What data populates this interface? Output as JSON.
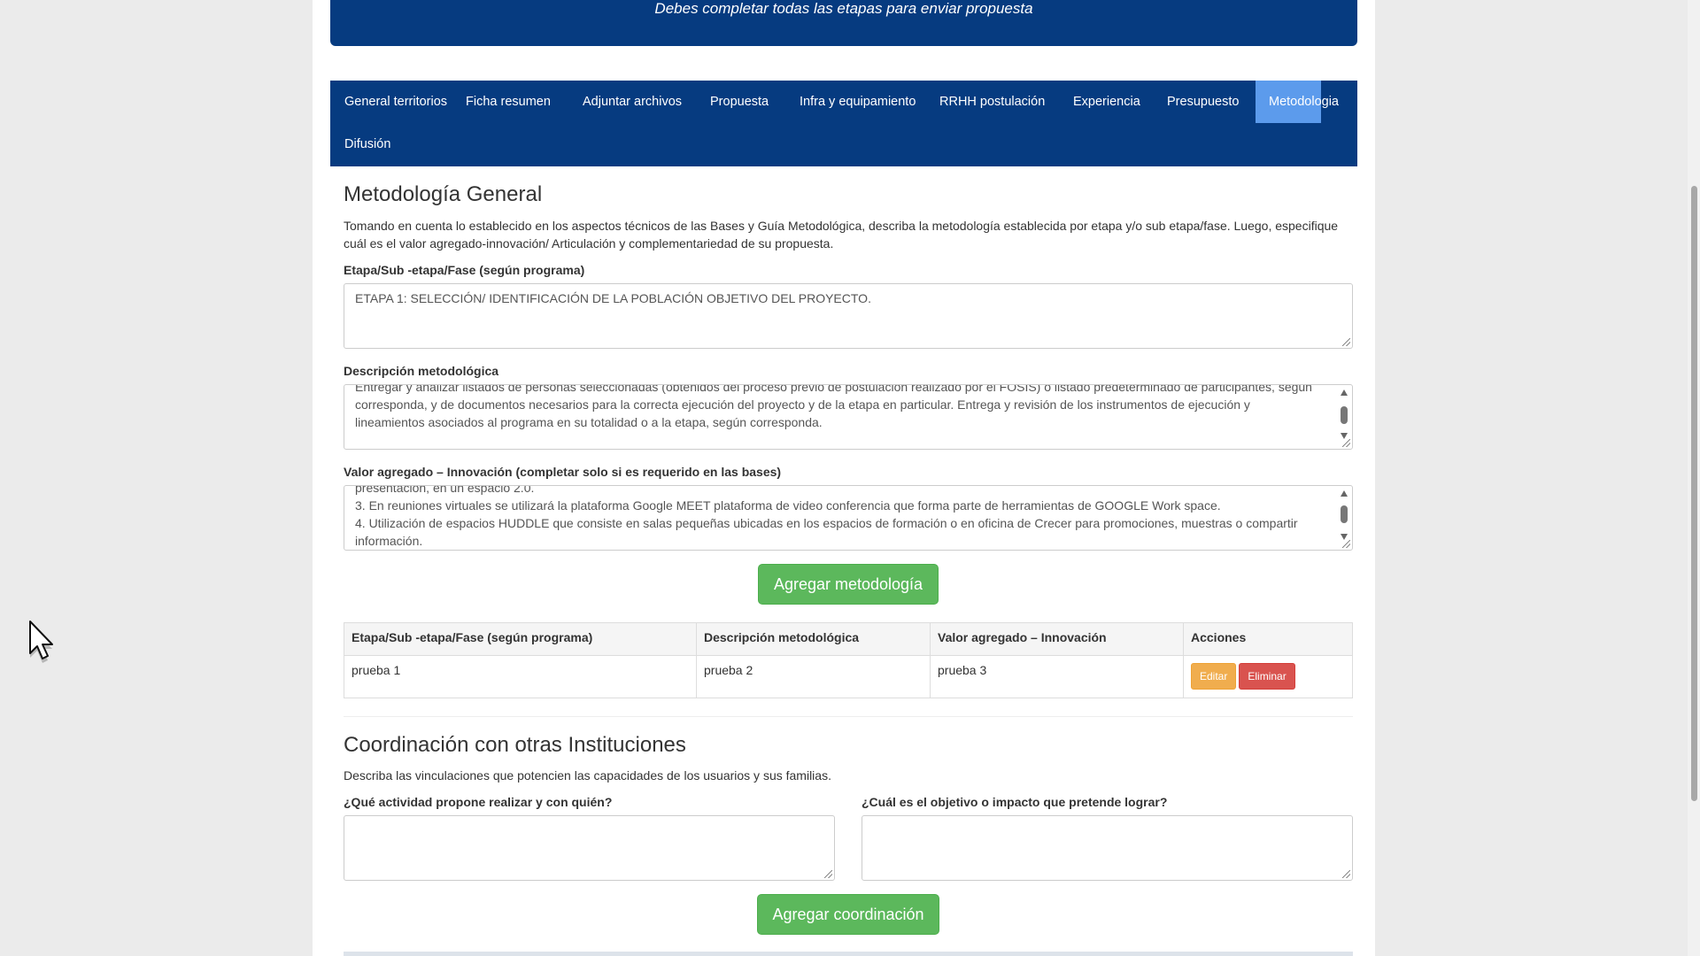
{
  "banner": {
    "text": "Debes completar todas las etapas para enviar propuesta"
  },
  "nav": {
    "items": [
      {
        "label": "General territorios",
        "active": false
      },
      {
        "label": "Ficha resumen",
        "active": false
      },
      {
        "label": "Adjuntar archivos",
        "active": false
      },
      {
        "label": "Propuesta",
        "active": false
      },
      {
        "label": "Infra y equipamiento",
        "active": false
      },
      {
        "label": "RRHH postulación",
        "active": false
      },
      {
        "label": "Experiencia",
        "active": false
      },
      {
        "label": "Presupuesto",
        "active": false
      },
      {
        "label": "Metodologia",
        "active": true
      },
      {
        "label": "Difusión",
        "active": false
      }
    ]
  },
  "metodologia": {
    "title": "Metodología General",
    "description": "Tomando en cuenta lo establecido en los aspectos técnicos de las Bases y Guía Metodológica, describa la metodología establecida por etapa y/o sub etapa/fase. Luego, especifique cuál es el valor agregado-innovación/ Articulación y complementariedad de su propuesta.",
    "etapa_label": "Etapa/Sub -etapa/Fase (según programa)",
    "etapa_value": "ETAPA 1: SELECCIÓN/ IDENTIFICACIÓN DE LA POBLACIÓN OBJETIVO DEL PROYECTO.",
    "descripcion_label": "Descripción metodológica",
    "descripcion_value_partial": "Entregar y analizar listados de personas seleccionadas (obtenidos del proceso previo de postulación realizado por el FOSIS) o listado predeterminado de participantes, según",
    "descripcion_value": "corresponda, y de documentos necesarios para la correcta ejecución del proyecto y de la etapa en particular. Entrega y revisión de los instrumentos de ejecución y lineamientos asociados al programa en su totalidad o a la etapa, según corresponda.",
    "valor_label": "Valor agregado – Innovación (completar solo si es requerido en las bases)",
    "valor_value_partial": "presentación, en un espacio 2.0.",
    "valor_line1": "3. En reuniones virtuales se utilizará la plataforma Google MEET plataforma de video conferencia que forma parte de herramientas de GOOGLE Work space.",
    "valor_line2": "4. Utilización de espacios HUDDLE que consiste en salas pequeñas ubicadas en los espacios de formación o en oficina de Crecer para promociones, muestras o compartir información.",
    "add_button": "Agregar metodología"
  },
  "table": {
    "headers": [
      "Etapa/Sub -etapa/Fase (según programa)",
      "Descripción metodológica",
      "Valor agregado – Innovación",
      "Acciones"
    ],
    "rows": [
      {
        "etapa": "prueba 1",
        "descripcion": "prueba 2",
        "valor": "prueba 3"
      }
    ],
    "edit_label": "Editar",
    "delete_label": "Eliminar"
  },
  "coordinacion": {
    "title": "Coordinación con otras Instituciones",
    "description": "Describa las vinculaciones que potencien las capacidades de los usuarios y sus familias.",
    "actividad_label": "¿Qué actividad propone realizar y con quién?",
    "objetivo_label": "¿Cuál es el objetivo o impacto que pretende lograr?",
    "add_button": "Agregar coordinación"
  },
  "colors": {
    "nav_bg": "#063b80",
    "nav_active": "#5c9bec",
    "success": "#5cb85c",
    "warning": "#f0ad4e",
    "danger": "#d9534f"
  }
}
